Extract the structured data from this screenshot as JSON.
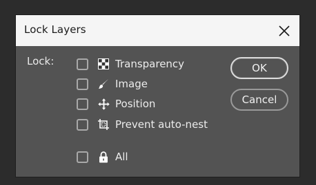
{
  "dialog": {
    "title": "Lock Layers",
    "lock_label": "Lock:",
    "options": [
      {
        "label": "Transparency",
        "icon": "checkerboard-icon",
        "checked": false
      },
      {
        "label": "Image",
        "icon": "brush-icon",
        "checked": false
      },
      {
        "label": "Position",
        "icon": "move-arrows-icon",
        "checked": false
      },
      {
        "label": "Prevent auto-nest",
        "icon": "artboard-icon",
        "checked": false
      },
      {
        "label": "All",
        "icon": "lock-icon",
        "checked": false
      }
    ],
    "ok_label": "OK",
    "cancel_label": "Cancel"
  },
  "colors": {
    "dialog_bg": "#535353",
    "titlebar_bg": "#f5f5f5",
    "text": "#ececec",
    "checkbox_border": "#a9a9a9"
  }
}
